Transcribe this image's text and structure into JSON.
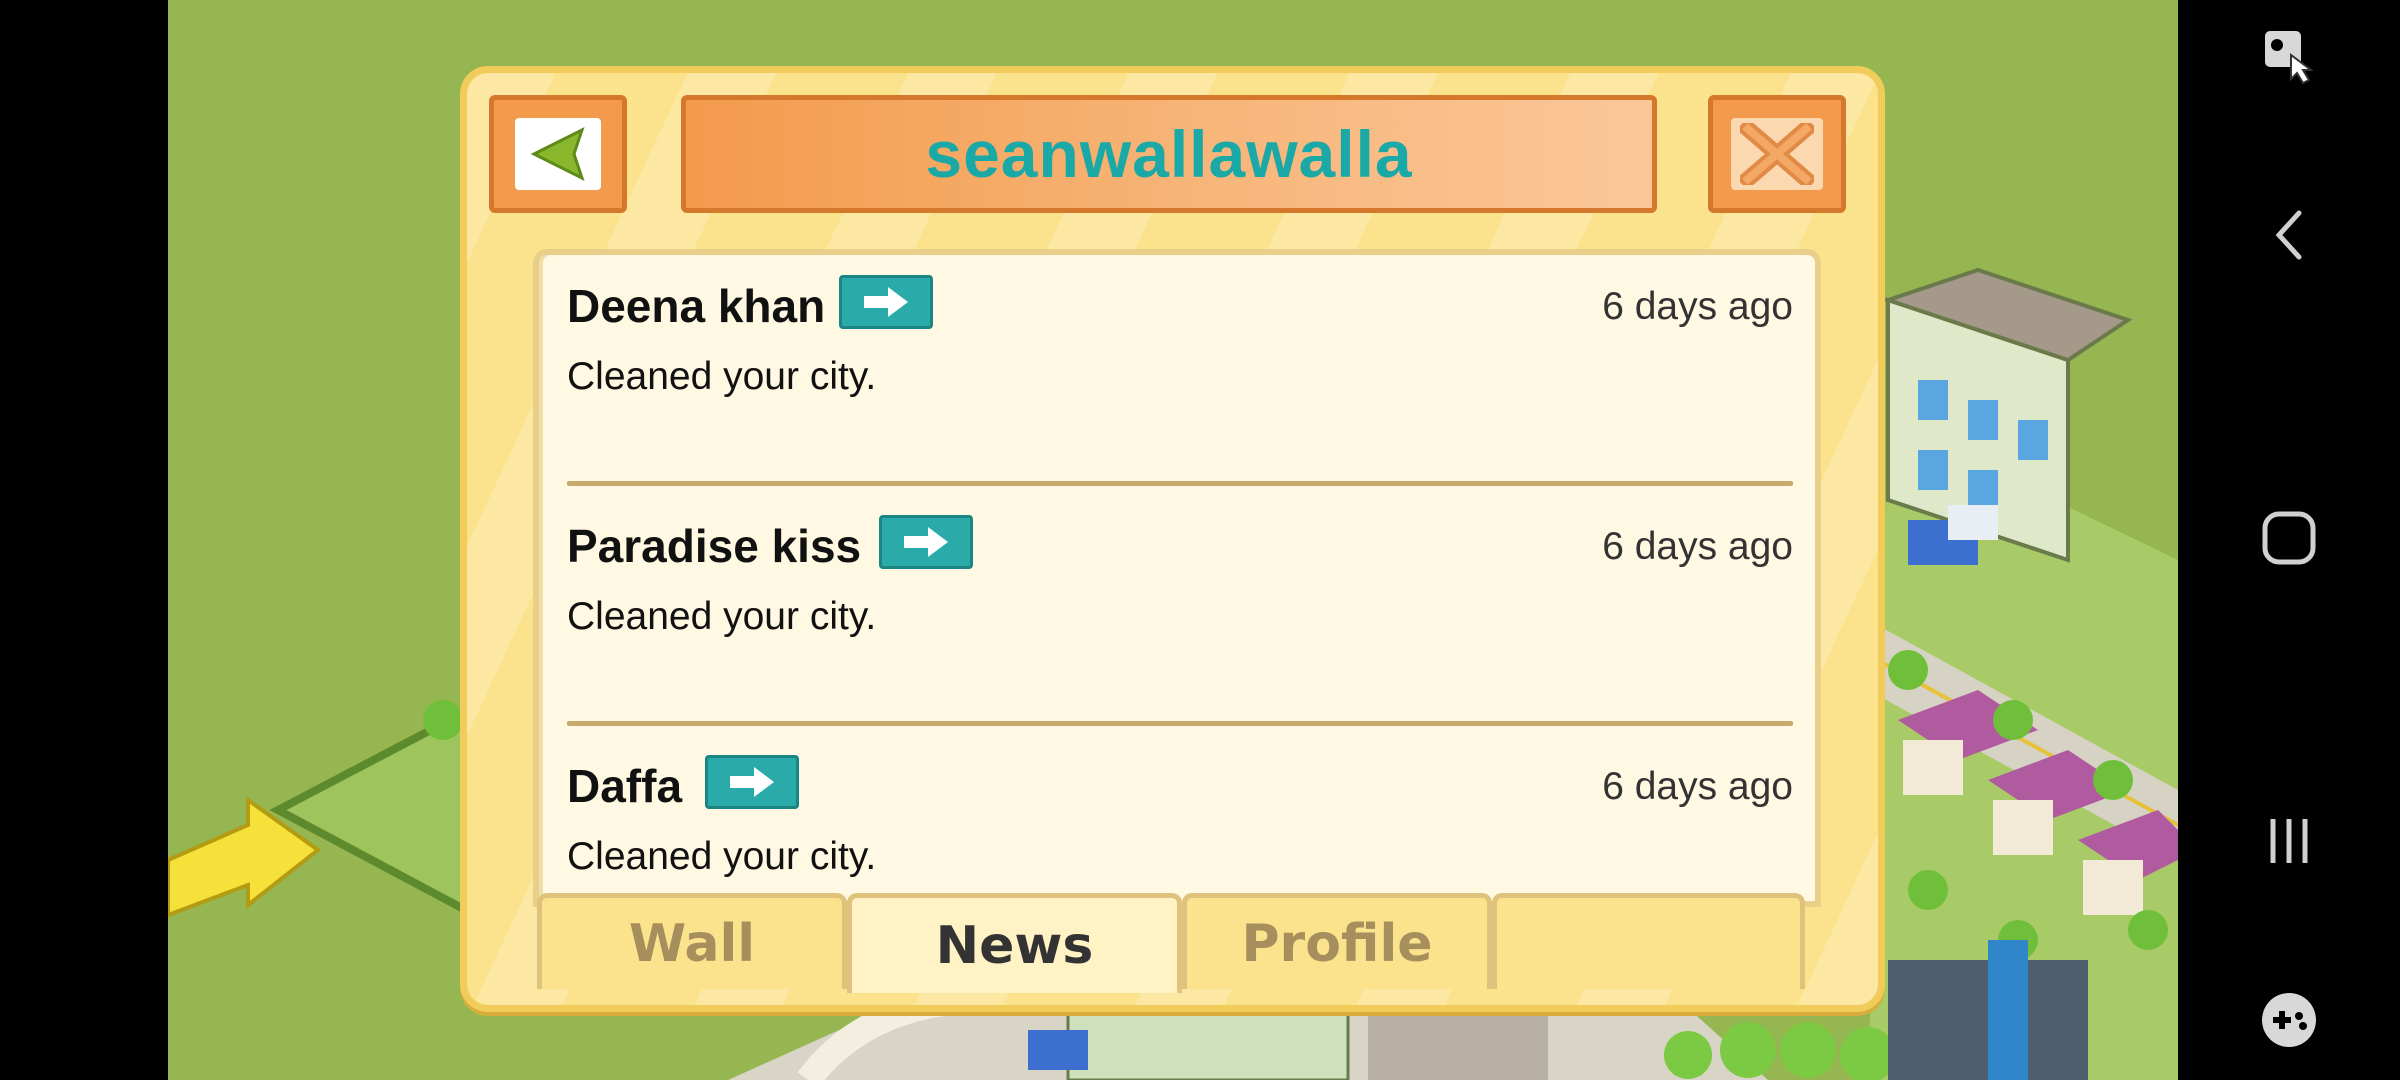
{
  "dialog": {
    "title": "seanwallawalla",
    "back_icon": "triangle-left-icon",
    "close_icon": "x-icon"
  },
  "feed": {
    "items": [
      {
        "name": "Deena khan",
        "time": "6 days ago",
        "message": "Cleaned your city."
      },
      {
        "name": "Paradise kiss",
        "time": "6 days ago",
        "message": "Cleaned your city."
      },
      {
        "name": "Daffa",
        "time": "6 days ago",
        "message": "Cleaned your city."
      }
    ]
  },
  "tabs": [
    {
      "label": "Wall",
      "active": false
    },
    {
      "label": "News",
      "active": true
    },
    {
      "label": "Profile",
      "active": false
    },
    {
      "label": "",
      "active": false
    }
  ],
  "navbar": {
    "icons": [
      "screenshot-tool-icon",
      "back-icon",
      "home-icon",
      "recents-icon",
      "game-tools-icon"
    ]
  },
  "colors": {
    "title": "#1aa9a6",
    "arrow_button": "#2aaba9",
    "dialog_bg": "#fbe38d",
    "header_orange": "#f39a4c"
  }
}
